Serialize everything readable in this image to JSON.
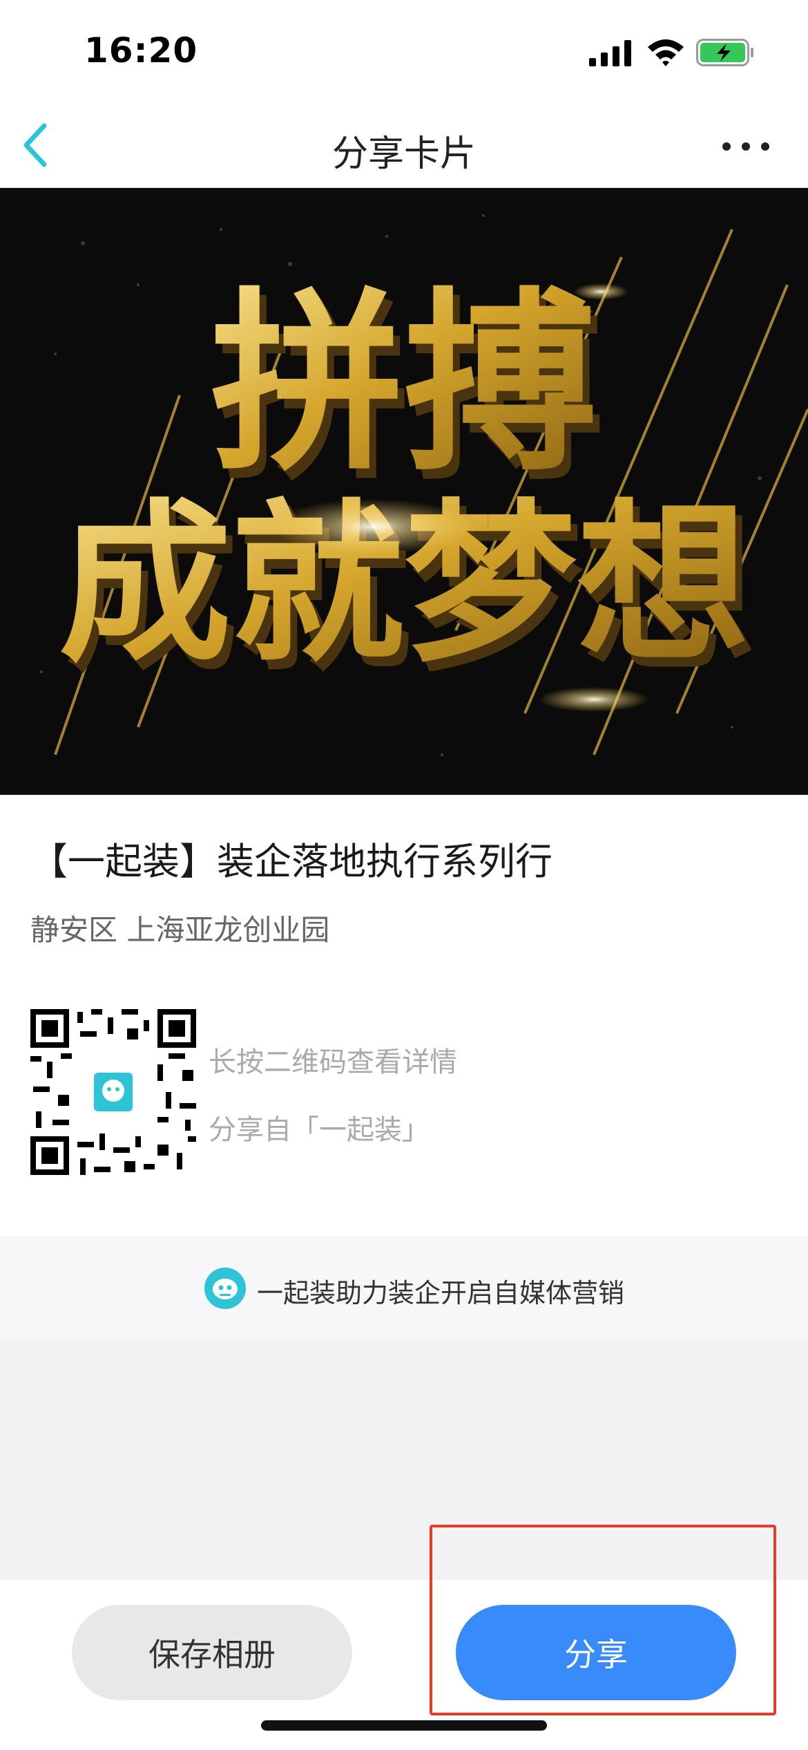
{
  "status_bar": {
    "time": "16:20"
  },
  "nav": {
    "title": "分享卡片"
  },
  "banner": {
    "line1": "拼搏",
    "line2": "成就梦想"
  },
  "event": {
    "title": "【一起装】装企落地执行系列行",
    "location": "静安区 上海亚龙创业园"
  },
  "qr": {
    "hint": "长按二维码查看详情",
    "source": "分享自「一起装」"
  },
  "footer": {
    "text": "一起装助力装企开启自媒体营销"
  },
  "actions": {
    "save_label": "保存相册",
    "share_label": "分享"
  },
  "colors": {
    "accent": "#3a8bfa",
    "brand_teal": "#2ec4d6",
    "highlight": "#e23c2a"
  },
  "icons": [
    "signal-icon",
    "wifi-icon",
    "battery-icon",
    "back-icon",
    "more-icon",
    "qr-code-icon",
    "brand-logo-icon"
  ]
}
